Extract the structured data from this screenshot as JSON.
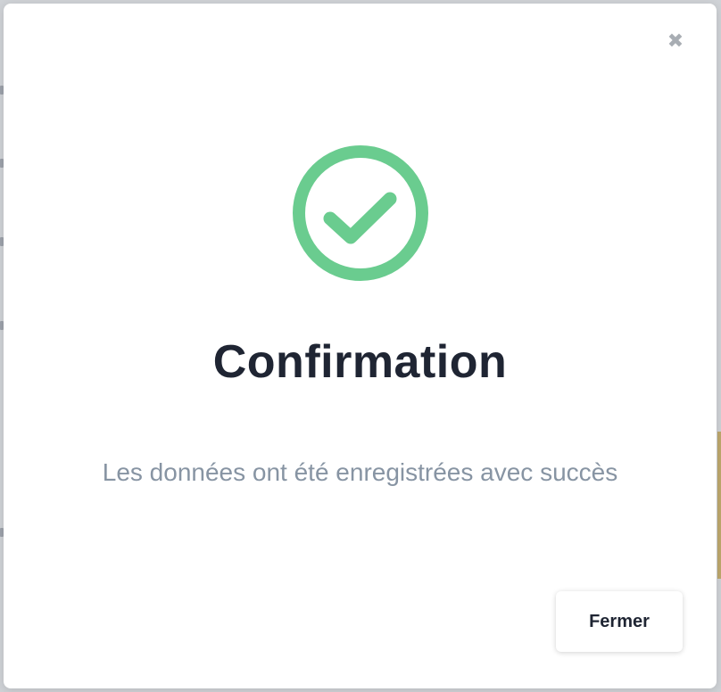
{
  "modal": {
    "close_glyph": "✖",
    "title": "Confirmation",
    "message": "Les données ont été enregistrées avec succès",
    "close_button_label": "Fermer",
    "accent_color": "#6acc8f"
  }
}
